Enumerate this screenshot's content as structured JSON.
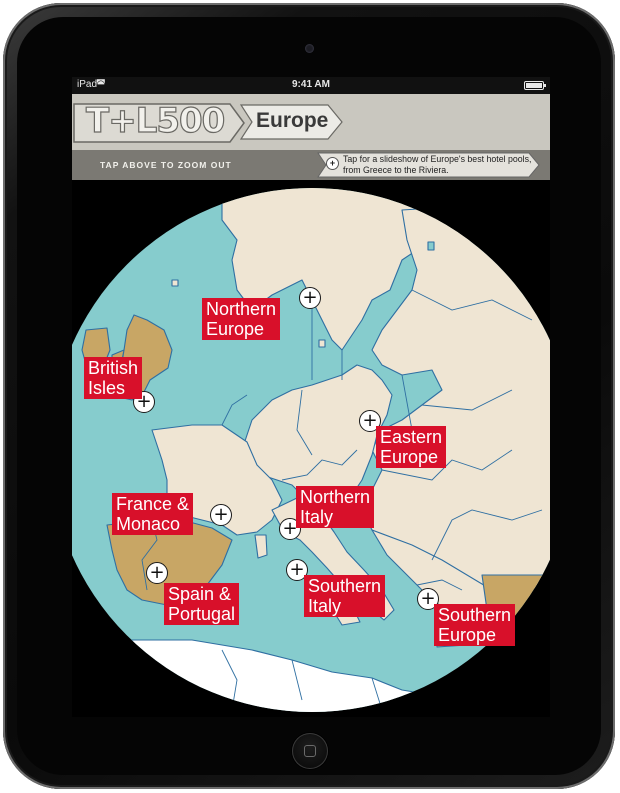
{
  "status_bar": {
    "carrier": "iPad",
    "time": "9:41 AM"
  },
  "header": {
    "logo": "T+L500",
    "section": "Europe"
  },
  "subbar": {
    "zoom_out_label": "TAP ABOVE TO ZOOM OUT",
    "slideshow_text": "Tap for a slideshow of Europe's best hotel pools, from Greece to the Riviera."
  },
  "colors": {
    "sea": "#86cccd",
    "land": "#efe5d3",
    "highlight": "#c8a665",
    "label": "#d8102a",
    "border": "#2f6fa2"
  },
  "regions": [
    {
      "label_line1": "Northern",
      "label_line2": "Europe"
    },
    {
      "label_line1": "British",
      "label_line2": "Isles"
    },
    {
      "label_line1": "Eastern",
      "label_line2": "Europe"
    },
    {
      "label_line1": "France &",
      "label_line2": "Monaco"
    },
    {
      "label_line1": "Northern",
      "label_line2": "Italy"
    },
    {
      "label_line1": "Spain &",
      "label_line2": "Portugal"
    },
    {
      "label_line1": "Southern",
      "label_line2": "Italy"
    },
    {
      "label_line1": "Southern",
      "label_line2": "Europe"
    }
  ]
}
